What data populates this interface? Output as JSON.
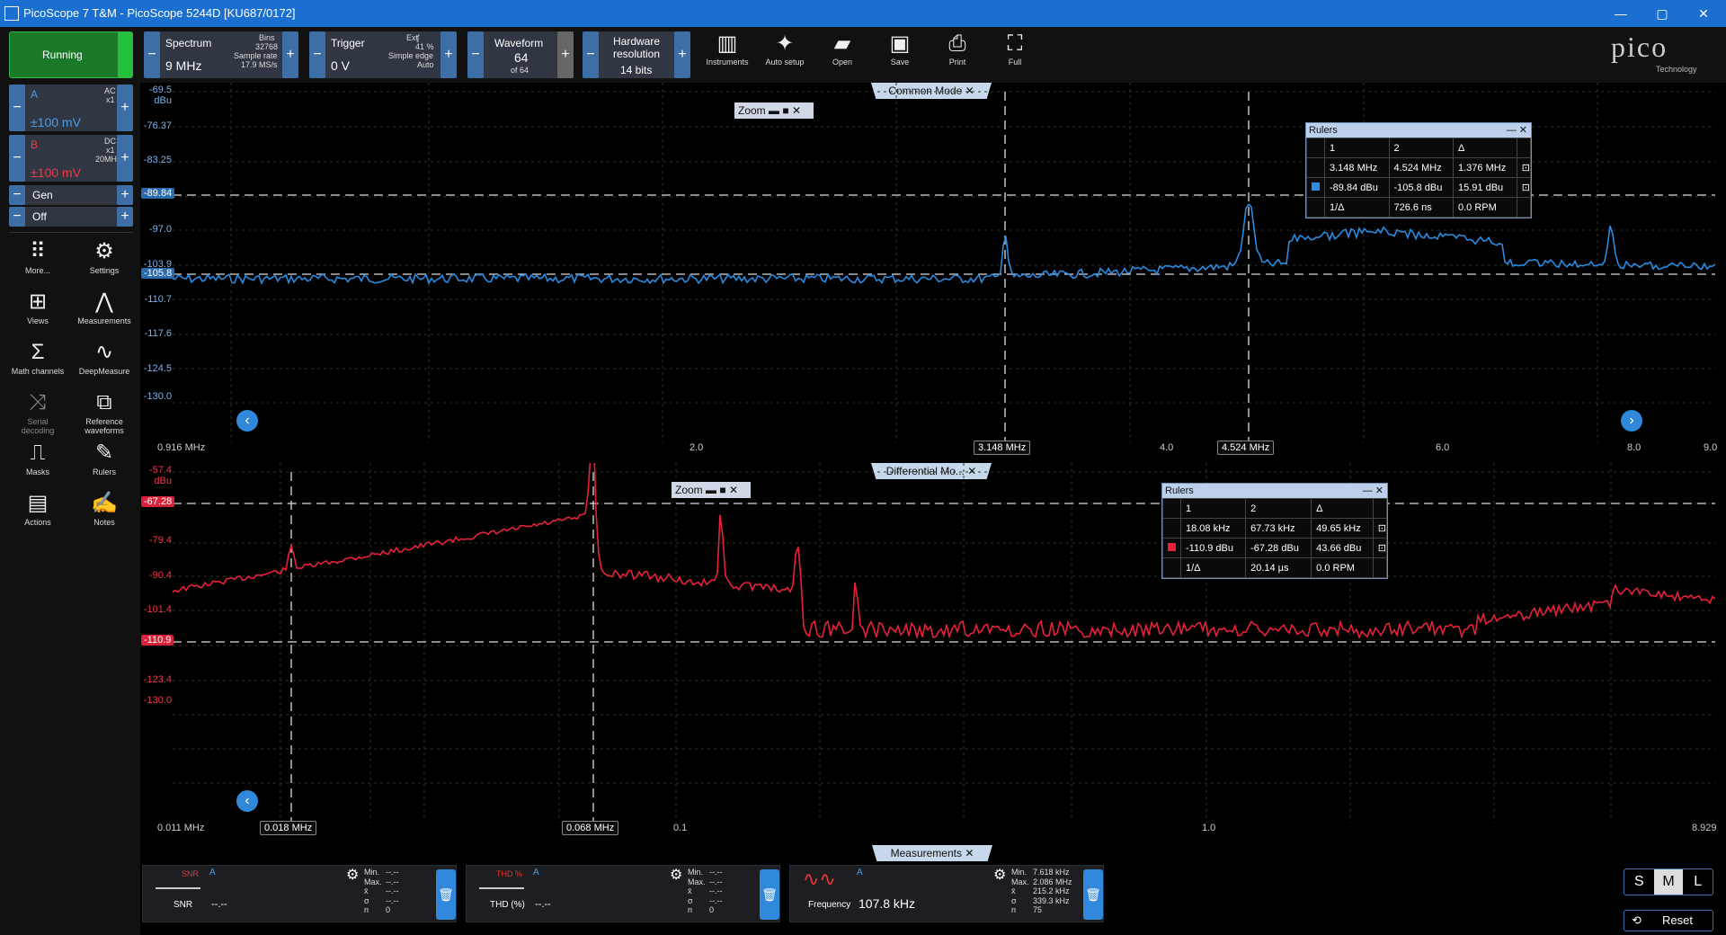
{
  "title_bar": {
    "title": "PicoScope 7 T&M  - PicoScope 5244D [KU687/0172]",
    "minimize": "—",
    "maximize": "▢",
    "close": "✕"
  },
  "toolbar": {
    "run_button": "Running",
    "mode": {
      "label": "Spectrum",
      "value": "9 MHz",
      "bins_label": "Bins",
      "bins": "32768",
      "sample_rate_label": "Sample rate",
      "sample_rate": "17.9 MS/s"
    },
    "trigger": {
      "label": "Trigger",
      "value": "0 V",
      "source": "Ext",
      "percent": "41 %",
      "type": "Simple edge",
      "mode": "Auto"
    },
    "waveform": {
      "label": "Waveform",
      "value": "64",
      "of": "of 64"
    },
    "hw_res": {
      "label": "Hardware resolution",
      "value": "14 bits"
    },
    "buttons": {
      "instruments": "Instruments",
      "auto_setup": "Auto setup",
      "open": "Open",
      "save": "Save",
      "print": "Print",
      "full": "Full"
    },
    "logo": {
      "word": "pico",
      "tag": "Technology"
    }
  },
  "sidebar": {
    "ch_a": {
      "name": "A",
      "coupling": "AC",
      "probe": "x1",
      "range": "±100 mV"
    },
    "ch_b": {
      "name": "B",
      "coupling": "DC",
      "probe": "x1",
      "bw": "20MHz",
      "range": "±100 mV"
    },
    "gen": "Gen",
    "off": "Off",
    "items": [
      "More...",
      "Settings",
      "Views",
      "Measurements",
      "Math channels",
      "DeepMeasure",
      "Serial decoding",
      "Reference waveforms",
      "Masks",
      "Rulers",
      "Actions",
      "Notes"
    ]
  },
  "top_view": {
    "tab": "Common Mode",
    "unit": "dBu",
    "y_ticks": [
      "-69.5",
      "-76.37",
      "-83.25",
      "-97.0",
      "-103.9",
      "-110.7",
      "-117.6",
      "-124.5",
      "-130.0"
    ],
    "x_ticks": [
      "0.916 MHz",
      "2.0",
      "4.0",
      "6.0",
      "8.0",
      "9.0"
    ],
    "cursor_y1": "-89.84",
    "cursor_y2": "-105.8",
    "cursor_x1": "3.148 MHz",
    "cursor_x2": "4.524 MHz",
    "zoom": "Zoom",
    "rulers": {
      "title": "Rulers",
      "c1": "1",
      "c2": "2",
      "delta": "Δ",
      "x1": "3.148 MHz",
      "x2": "4.524 MHz",
      "dx": "1.376 MHz",
      "y1": "-89.84 dBu",
      "y2": "-105.8 dBu",
      "dy": "15.91 dBu",
      "inv_label": "1/Δ",
      "inv": "726.6 ns",
      "rpm": "0.0 RPM"
    },
    "trace_color": "#2b8be0"
  },
  "bottom_view": {
    "tab": "Differential Mo...",
    "unit": "dBu",
    "y_ticks": [
      "-57.4",
      "-79.4",
      "-90.4",
      "-101.4",
      "-123.4",
      "-130.0"
    ],
    "x_ticks": [
      "0.011 MHz",
      "0.1",
      "1.0",
      "8.929"
    ],
    "cursor_y1": "-67.28",
    "cursor_y2": "-110.9",
    "cursor_x1": "0.018 MHz",
    "cursor_x2": "0.068 MHz",
    "zoom": "Zoom",
    "rulers": {
      "title": "Rulers",
      "c1": "1",
      "c2": "2",
      "delta": "Δ",
      "x1": "18.08 kHz",
      "x2": "67.73 kHz",
      "dx": "49.65 kHz",
      "y1": "-110.9 dBu",
      "y2": "-67.28 dBu",
      "dy": "43.66 dBu",
      "inv_label": "1/Δ",
      "inv": "20.14 µs",
      "rpm": "0.0 RPM"
    },
    "trace_color": "#e8213a"
  },
  "measurements": {
    "tab": "Measurements",
    "stat_labels": [
      "Min.",
      "Max.",
      "x̄",
      "σ",
      "n"
    ],
    "cards": [
      {
        "name": "SNR",
        "channel": "A",
        "value": "--.--",
        "icon_text": "SNR",
        "stats": [
          "--.--",
          "--.--",
          "--.--",
          "--.--",
          "0"
        ]
      },
      {
        "name": "THD (%)",
        "channel": "A",
        "value": "--.--",
        "icon_text": "THD %",
        "stats": [
          "--.--",
          "--.--",
          "--.--",
          "--.--",
          "0"
        ]
      },
      {
        "name": "Frequency",
        "channel": "A",
        "value": "107.8 kHz",
        "icon_text": "",
        "stats": [
          "7.618 kHz",
          "2.086 MHz",
          "215.2 kHz",
          "339.3 kHz",
          "75"
        ]
      }
    ],
    "size": {
      "s": "S",
      "m": "M",
      "l": "L"
    },
    "reset": "Reset"
  }
}
